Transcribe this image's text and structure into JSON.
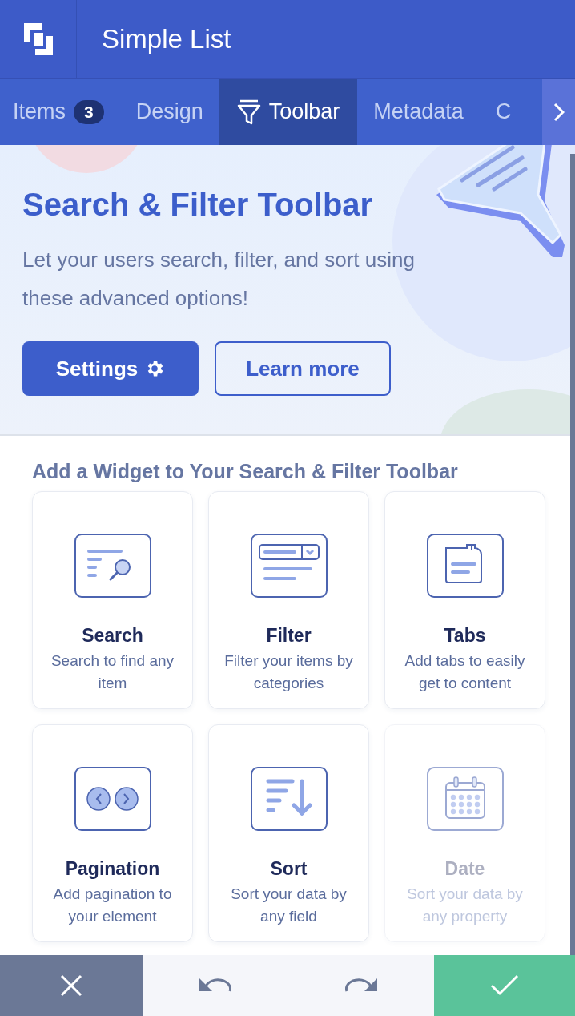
{
  "header": {
    "title": "Simple List"
  },
  "tabs": [
    {
      "kind": "text",
      "label": "Items",
      "badge": "3",
      "selected": false
    },
    {
      "kind": "text",
      "label": "Design",
      "selected": false
    },
    {
      "kind": "icon",
      "label": "Toolbar",
      "selected": true
    },
    {
      "kind": "text",
      "label": "Metadata",
      "selected": false
    },
    {
      "kind": "text",
      "label": "C",
      "selected": false
    }
  ],
  "hero": {
    "title": "Search & Filter Toolbar",
    "description": "Let your users search, filter, and sort using these advanced options!",
    "primary_button": "Settings",
    "secondary_button": "Learn more"
  },
  "widgets": {
    "heading": "Add a Widget to Your Search & Filter Toolbar",
    "items": [
      {
        "kind": "search",
        "title": "Search",
        "description": "Search to find any item",
        "disabled": false
      },
      {
        "kind": "filter",
        "title": "Filter",
        "description": "Filter your items by categories",
        "disabled": false
      },
      {
        "kind": "tabs",
        "title": "Tabs",
        "description": "Add tabs to easily get to content",
        "disabled": false
      },
      {
        "kind": "pagination",
        "title": "Pagination",
        "description": "Add pagination to your element",
        "disabled": false
      },
      {
        "kind": "sort",
        "title": "Sort",
        "description": "Sort your data by any field",
        "disabled": false
      },
      {
        "kind": "date",
        "title": "Date",
        "description": "Sort your data by any property",
        "disabled": true
      }
    ]
  }
}
